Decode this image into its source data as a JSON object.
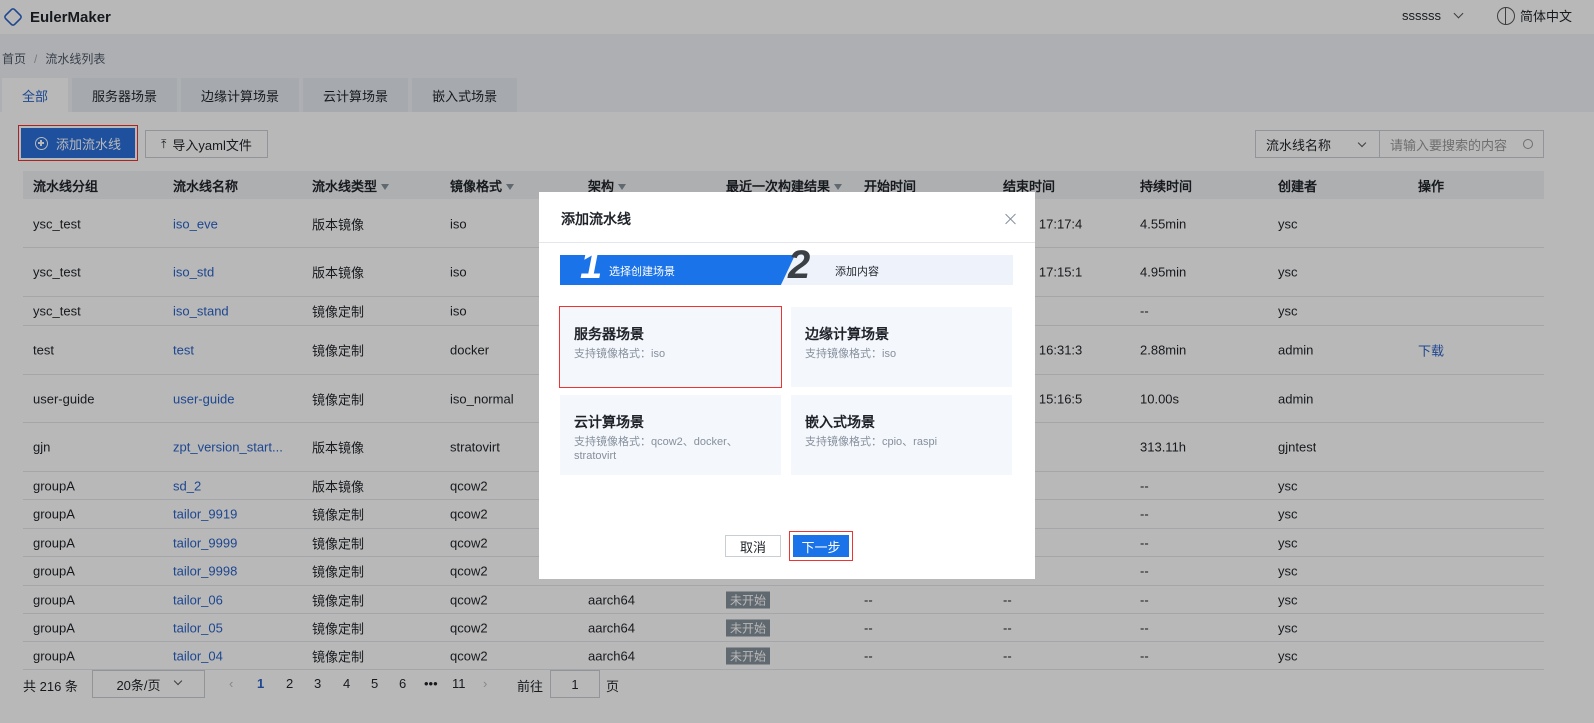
{
  "header": {
    "app_name": "EulerMaker",
    "user_name": "ssssss",
    "language": "简体中文"
  },
  "breadcrumb": [
    "首页",
    "流水线列表"
  ],
  "breadcrumb_sep": "/",
  "tabs": [
    "全部",
    "服务器场景",
    "边缘计算场景",
    "云计算场景",
    "嵌入式场景"
  ],
  "active_tab": "全部",
  "toolbar": {
    "add_label": "添加流水线",
    "import_label": "导入yaml文件",
    "search_field": "流水线名称",
    "search_placeholder": "请输入要搜索的内容"
  },
  "table": {
    "columns": [
      "流水线分组",
      "流水线名称",
      "流水线类型",
      "镜像格式",
      "架构",
      "最近一次构建结果",
      "开始时间",
      "结束时间",
      "持续时间",
      "创建者",
      "操作"
    ],
    "rows": [
      {
        "group": "ysc_test",
        "name": "iso_eve",
        "type": "版本镜像",
        "format": "iso",
        "arch": "",
        "result": "",
        "start": "",
        "end": "11-28 17:17:4",
        "duration": "4.55min",
        "creator": "ysc",
        "action": ""
      },
      {
        "group": "ysc_test",
        "name": "iso_std",
        "type": "版本镜像",
        "format": "iso",
        "arch": "",
        "result": "",
        "start": "",
        "end": "11-28 17:15:1",
        "duration": "4.95min",
        "creator": "ysc",
        "action": ""
      },
      {
        "group": "ysc_test",
        "name": "iso_stand",
        "type": "镜像定制",
        "format": "iso",
        "arch": "",
        "result": "",
        "start": "",
        "end": "",
        "duration": "--",
        "creator": "ysc",
        "action": ""
      },
      {
        "group": "test",
        "name": "test",
        "type": "镜像定制",
        "format": "docker",
        "arch": "",
        "result": "",
        "start": "",
        "end": "11-24 16:31:3",
        "duration": "2.88min",
        "creator": "admin",
        "action": "下载"
      },
      {
        "group": "user-guide",
        "name": "user-guide",
        "type": "镜像定制",
        "format": "iso_normal",
        "arch": "",
        "result": "",
        "start": "",
        "end": "11-21 15:16:5",
        "duration": "10.00s",
        "creator": "admin",
        "action": ""
      },
      {
        "group": "gjn",
        "name": "zpt_version_start...",
        "type": "版本镜像",
        "format": "stratovirt",
        "arch": "",
        "result": "",
        "start": "",
        "end": "",
        "duration": "313.11h",
        "creator": "gjntest",
        "action": ""
      },
      {
        "group": "groupA",
        "name": "sd_2",
        "type": "版本镜像",
        "format": "qcow2",
        "arch": "",
        "result": "",
        "start": "",
        "end": "",
        "duration": "--",
        "creator": "ysc",
        "action": ""
      },
      {
        "group": "groupA",
        "name": "tailor_9919",
        "type": "镜像定制",
        "format": "qcow2",
        "arch": "",
        "result": "",
        "start": "",
        "end": "",
        "duration": "--",
        "creator": "ysc",
        "action": ""
      },
      {
        "group": "groupA",
        "name": "tailor_9999",
        "type": "镜像定制",
        "format": "qcow2",
        "arch": "",
        "result": "",
        "start": "",
        "end": "",
        "duration": "--",
        "creator": "ysc",
        "action": ""
      },
      {
        "group": "groupA",
        "name": "tailor_9998",
        "type": "镜像定制",
        "format": "qcow2",
        "arch": "",
        "result": "",
        "start": "",
        "end": "",
        "duration": "--",
        "creator": "ysc",
        "action": ""
      },
      {
        "group": "groupA",
        "name": "tailor_06",
        "type": "镜像定制",
        "format": "qcow2",
        "arch": "aarch64",
        "result": "未开始",
        "start": "--",
        "end": "--",
        "duration": "--",
        "creator": "ysc",
        "action": ""
      },
      {
        "group": "groupA",
        "name": "tailor_05",
        "type": "镜像定制",
        "format": "qcow2",
        "arch": "aarch64",
        "result": "未开始",
        "start": "--",
        "end": "--",
        "duration": "--",
        "creator": "ysc",
        "action": ""
      },
      {
        "group": "groupA",
        "name": "tailor_04",
        "type": "镜像定制",
        "format": "qcow2",
        "arch": "aarch64",
        "result": "未开始",
        "start": "--",
        "end": "--",
        "duration": "--",
        "creator": "ysc",
        "action": ""
      }
    ]
  },
  "pagination": {
    "total": "共 216 条",
    "page_size": "20条/页",
    "pages": [
      "1",
      "2",
      "3",
      "4",
      "5",
      "6",
      "•••",
      "11"
    ],
    "current": "1",
    "goto_label": "前往",
    "goto_value": "1",
    "page_suffix": "页"
  },
  "dialog": {
    "title": "添加流水线",
    "steps": [
      {
        "num": "1",
        "label": "选择创建场景"
      },
      {
        "num": "2",
        "label": "添加内容"
      }
    ],
    "scenes": [
      {
        "title": "服务器场景",
        "desc": "支持镜像格式：iso"
      },
      {
        "title": "边缘计算场景",
        "desc": "支持镜像格式：iso"
      },
      {
        "title": "云计算场景",
        "desc": "支持镜像格式：qcow2、docker、stratovirt"
      },
      {
        "title": "嵌入式场景",
        "desc": "支持镜像格式：cpio、raspi"
      }
    ],
    "cancel_label": "取消",
    "next_label": "下一步"
  },
  "colors": {
    "primary": "#1a73e8",
    "link": "#2a63c8",
    "highlight": "#e33333",
    "badge": "#86909c"
  }
}
